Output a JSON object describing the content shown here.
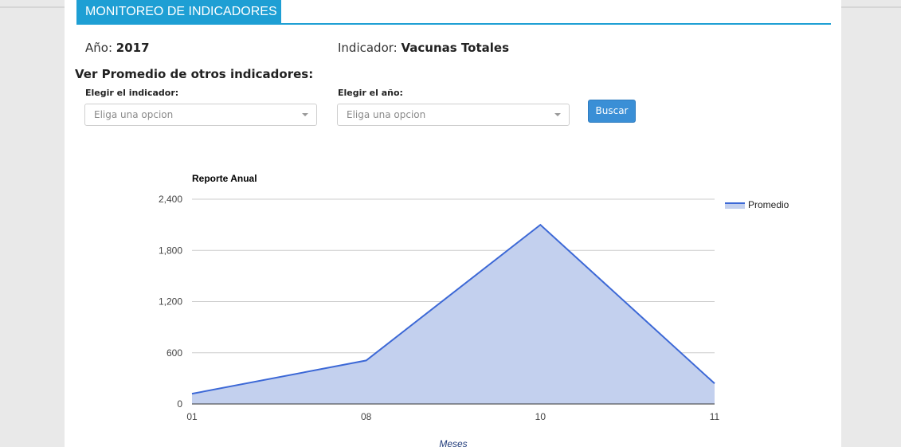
{
  "header": {
    "section_title": "MONITOREO DE INDICADORES"
  },
  "info": {
    "year_label": "Año:",
    "year_value": "2017",
    "indicator_label": "Indicador:",
    "indicator_value": "Vacunas Totales"
  },
  "filters": {
    "title": "Ver Promedio de otros indicadores:",
    "indicator_label": "Elegir el indicador:",
    "indicator_placeholder": "Eliga una opcion",
    "year_label": "Elegir el año:",
    "year_placeholder": "Eliga una opcion",
    "search_button": "Buscar"
  },
  "colors": {
    "accent": "#1e9fd4",
    "button": "#3a8fd6",
    "series_line": "#3c68d6",
    "series_fill": "#c3d0ee"
  },
  "chart_data": {
    "type": "area",
    "title": "Reporte Anual",
    "xlabel": "Meses",
    "ylabel": "",
    "categories": [
      "01",
      "08",
      "10",
      "11"
    ],
    "series": [
      {
        "name": "Promedio",
        "values": [
          120,
          510,
          2100,
          240
        ]
      }
    ],
    "ylim": [
      0,
      2400
    ],
    "yticks": [
      0,
      600,
      1200,
      1800,
      2400
    ],
    "ytick_labels": [
      "0",
      "600",
      "1,200",
      "1,800",
      "2,400"
    ],
    "grid": true,
    "legend_position": "right"
  }
}
